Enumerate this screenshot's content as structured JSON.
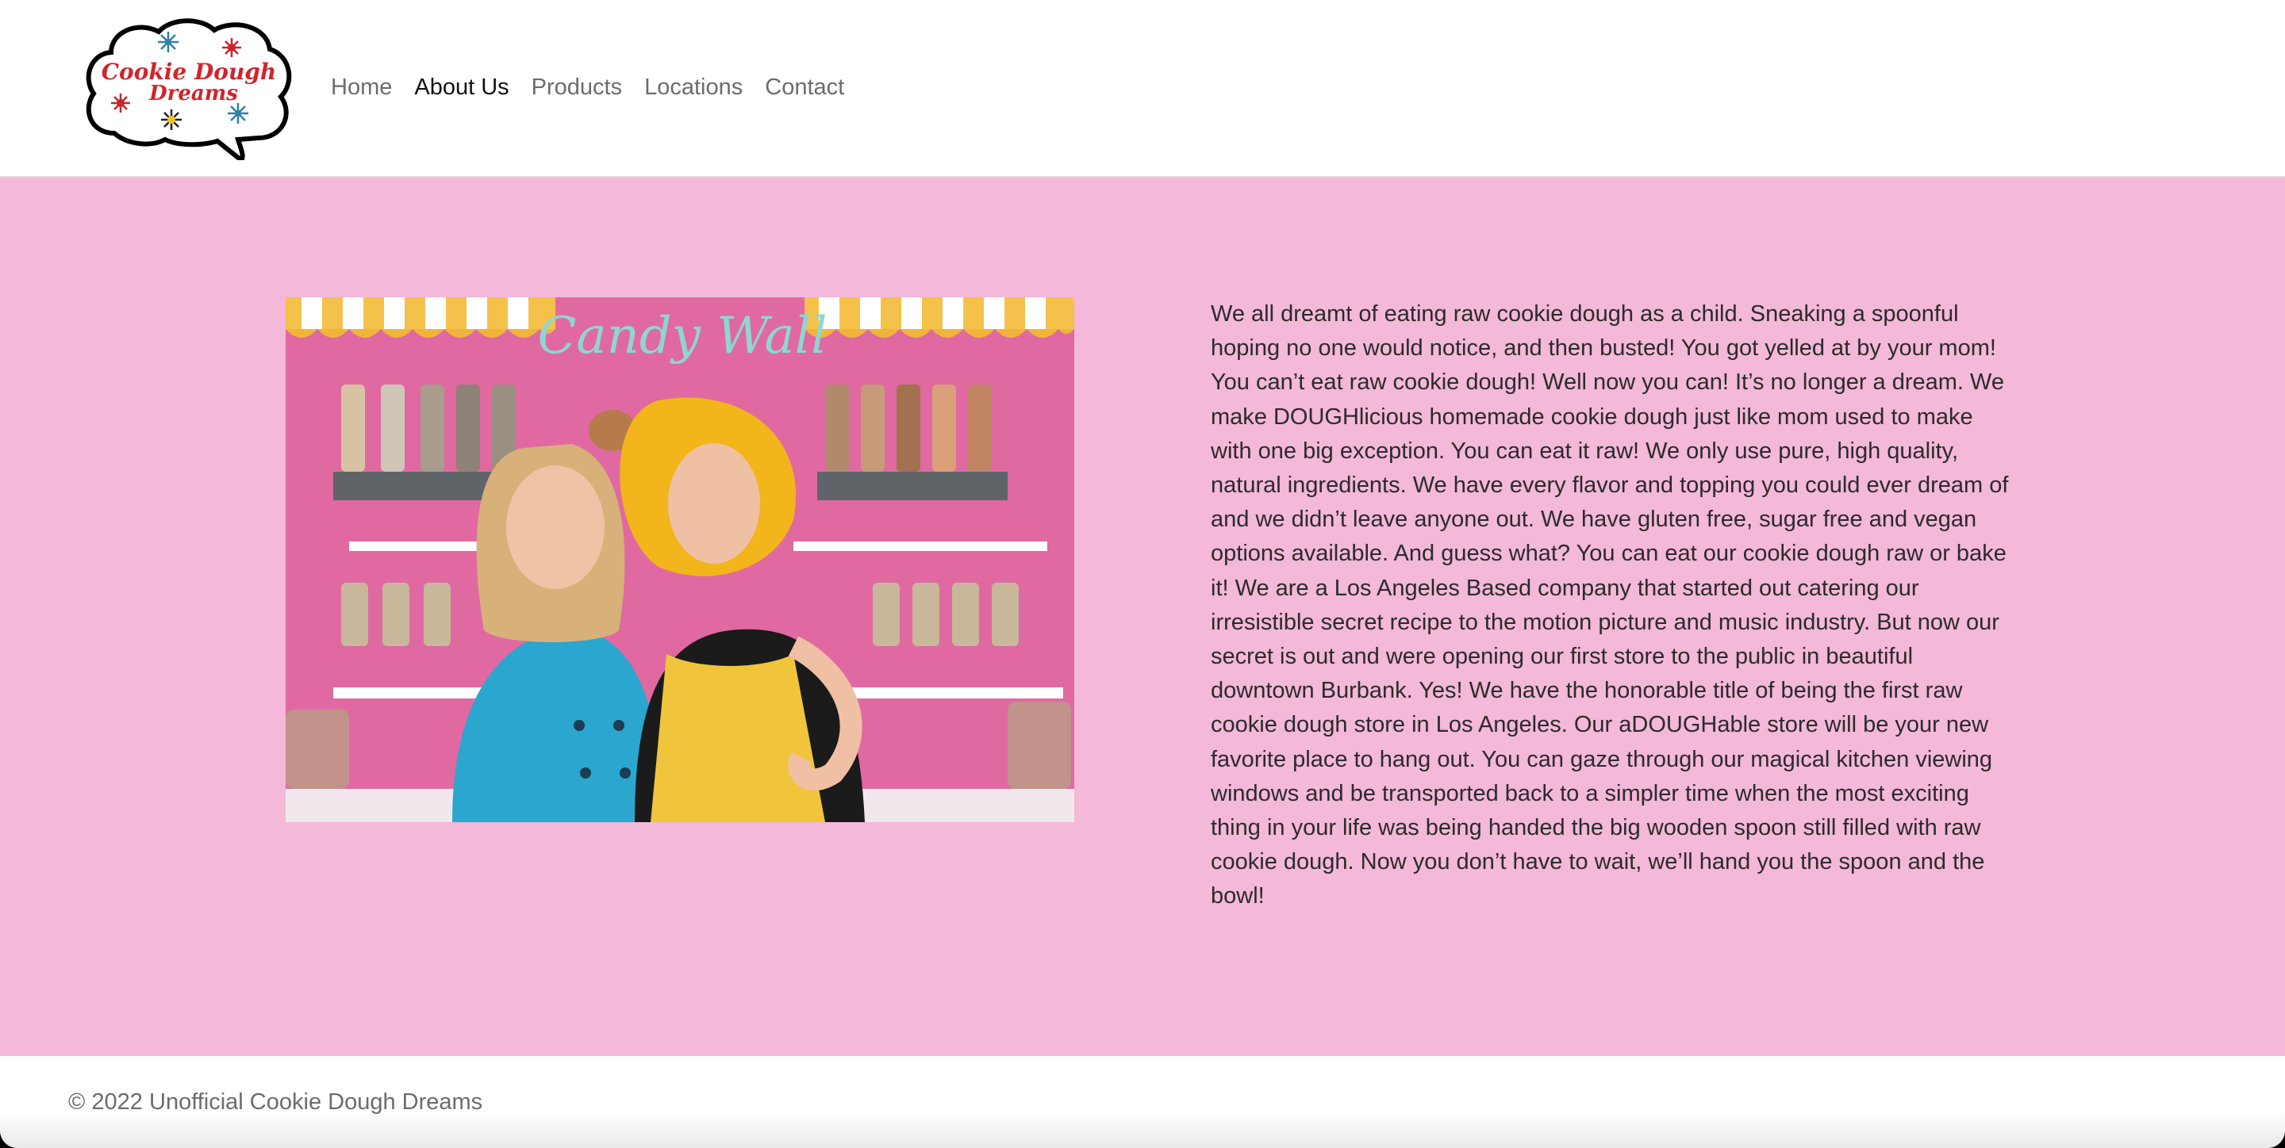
{
  "brand": {
    "logo_line1": "Cookie Dough",
    "logo_line2": "Dreams",
    "logo_icon": "starburst-cloud-logo"
  },
  "nav": {
    "items": [
      {
        "label": "Home",
        "active": false
      },
      {
        "label": "About Us",
        "active": true
      },
      {
        "label": "Products",
        "active": false
      },
      {
        "label": "Locations",
        "active": false
      },
      {
        "label": "Contact",
        "active": false
      }
    ]
  },
  "photo": {
    "sign_text": "Candy Wall"
  },
  "about": {
    "paragraph": "We all dreamt of eating raw cookie dough as a child. Sneaking a spoonful hoping no one would notice, and then busted! You got yelled at by your mom! You can’t eat raw cookie dough! Well now you can! It’s no longer a dream. We make DOUGHlicious homemade cookie dough just like mom used to make with one big exception. You can eat it raw! We only use pure, high quality, natural ingredients. We have every flavor and topping you could ever dream of and we didn’t leave anyone out. We have gluten free, sugar free and vegan options available. And guess what? You can eat our cookie dough raw or bake it! We are a Los Angeles Based company that started out catering our irresistible secret recipe to the motion picture and music industry. But now our secret is out and were opening our first store to the public in beautiful downtown Burbank. Yes! We have the honorable title of being the first raw cookie dough store in Los Angeles. Our aDOUGHable store will be your new favorite place to hang out. You can gaze through our magical kitchen viewing windows and be transported back to a simpler time when the most exciting thing in your life was being handed the big wooden spoon still filled with raw cookie dough. Now you don’t have to wait, we’ll hand you the spoon and the bowl!"
  },
  "footer": {
    "text": "© 2022 Unofficial Cookie Dough Dreams"
  },
  "colors": {
    "main_background": "#f4b8d8",
    "nav_active": "#111111",
    "nav_inactive": "#6c6c6c"
  }
}
